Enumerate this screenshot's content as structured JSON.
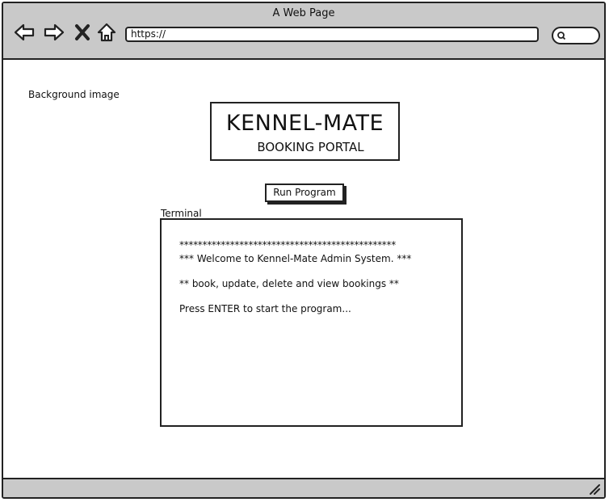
{
  "window": {
    "title": "A Web Page"
  },
  "toolbar": {
    "back_icon": "back-arrow-icon",
    "forward_icon": "forward-arrow-icon",
    "stop_icon": "close-x-icon",
    "home_icon": "home-icon",
    "url_value": "https://",
    "search_icon": "search-icon"
  },
  "page": {
    "background_label": "Background image",
    "logo": {
      "title": "KENNEL-MATE",
      "subtitle": "BOOKING PORTAL"
    },
    "run_button_label": "Run Program",
    "terminal": {
      "label": "Terminal",
      "lines": [
        "***********************************************",
        "*** Welcome to Kennel-Mate Admin System. ***",
        "** book, update, delete and view bookings **",
        "Press ENTER to start the program..."
      ]
    }
  },
  "colors": {
    "chrome": "#c9c9c9",
    "stroke": "#222222",
    "page_bg": "#ffffff"
  }
}
